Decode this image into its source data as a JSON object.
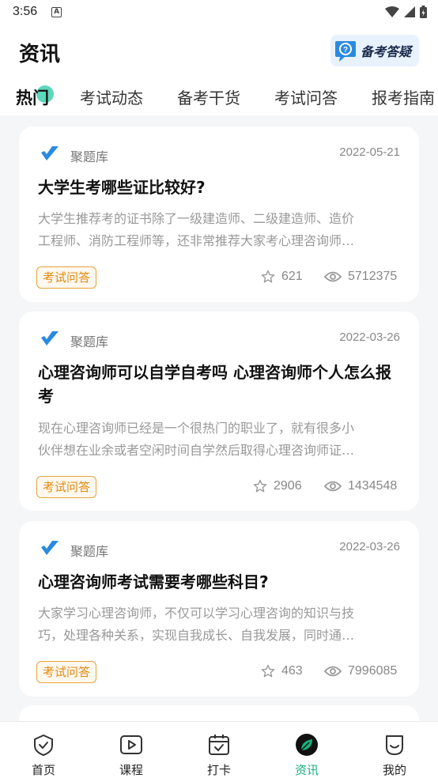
{
  "status_bar": {
    "time": "3:56",
    "notification_letter": "A"
  },
  "header": {
    "title": "资讯",
    "qa_button_label": "备考答疑"
  },
  "tabs": [
    {
      "label": "热门",
      "active": true
    },
    {
      "label": "考试动态",
      "active": false
    },
    {
      "label": "备考干货",
      "active": false
    },
    {
      "label": "考试问答",
      "active": false
    },
    {
      "label": "报考指南",
      "active": false
    }
  ],
  "articles": [
    {
      "source": "聚题库",
      "date": "2022-05-21",
      "title": "大学生考哪些证比较好?",
      "summary_line1": "大学生推荐考的证书除了一级建造师、二级建造师、造价",
      "summary_line2": "工程师、消防工程师等，还非常推荐大家考心理咨询师…",
      "tag": "考试问答",
      "stars": "621",
      "views": "5712375"
    },
    {
      "source": "聚题库",
      "date": "2022-03-26",
      "title": "心理咨询师可以自学自考吗 心理咨询师个人怎么报考",
      "summary_line1": "现在心理咨询师已经是一个很热门的职业了，就有很多小",
      "summary_line2": "伙伴想在业余或者空闲时间自学然后取得心理咨询师证…",
      "tag": "考试问答",
      "stars": "2906",
      "views": "1434548"
    },
    {
      "source": "聚题库",
      "date": "2022-03-26",
      "title": "心理咨询师考试需要考哪些科目?",
      "summary_line1": "大家学习心理咨询师，不仅可以学习心理咨询的知识与技",
      "summary_line2": "巧，处理各种关系，实现自我成长、自我发展，同时通…",
      "tag": "考试问答",
      "stars": "463",
      "views": "7996085"
    }
  ],
  "bottom_nav": [
    {
      "label": "首页",
      "icon": "home-shield-icon",
      "active": false
    },
    {
      "label": "课程",
      "icon": "play-icon",
      "active": false
    },
    {
      "label": "打卡",
      "icon": "calendar-check-icon",
      "active": false
    },
    {
      "label": "资讯",
      "icon": "leaf-icon",
      "active": true
    },
    {
      "label": "我的",
      "icon": "profile-icon",
      "active": false
    }
  ],
  "colors": {
    "accent": "#16b07d",
    "tag": "#e08a12",
    "brand_blue": "#2a8ae0"
  }
}
